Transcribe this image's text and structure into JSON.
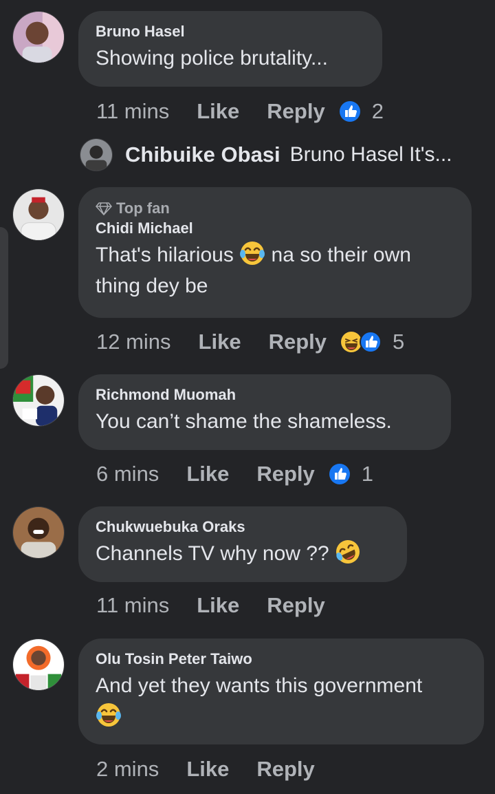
{
  "comments": [
    {
      "author": "Bruno Hasel",
      "text": "Showing police brutality...",
      "time": "11 mins",
      "like_label": "Like",
      "reply_label": "Reply",
      "reaction_count": "2",
      "reaction_icons": [
        "like-icon"
      ]
    },
    {
      "badge": "Top fan",
      "author": "Chidi Michael",
      "text_line1": "That's hilarious",
      "text_line1_end": "na so their own",
      "text_line2": "thing dey be",
      "time": "12 mins",
      "like_label": "Like",
      "reply_label": "Reply",
      "reaction_count": "5",
      "reaction_icons": [
        "haha-icon",
        "like-icon"
      ]
    },
    {
      "author": "Richmond Muomah",
      "text": "You can’t shame the shameless.",
      "time": "6 mins",
      "like_label": "Like",
      "reply_label": "Reply",
      "reaction_count": "1",
      "reaction_icons": [
        "like-icon"
      ]
    },
    {
      "author": "Chukwuebuka Oraks",
      "text": "Channels TV why now ??",
      "time": "11 mins",
      "like_label": "Like",
      "reply_label": "Reply"
    },
    {
      "author": "Olu Tosin Peter Taiwo",
      "text": "And yet they wants this government",
      "time": "2 mins",
      "like_label": "Like",
      "reply_label": "Reply"
    }
  ],
  "reply_preview": {
    "author": "Chibuike Obasi",
    "text": "Bruno Hasel It's..."
  },
  "colors": {
    "background": "#232427",
    "bubble": "#36383b",
    "secondary_text": "#b0b3b8",
    "like_blue": "#1877f2",
    "haha_yellow": "#f7c53b"
  }
}
